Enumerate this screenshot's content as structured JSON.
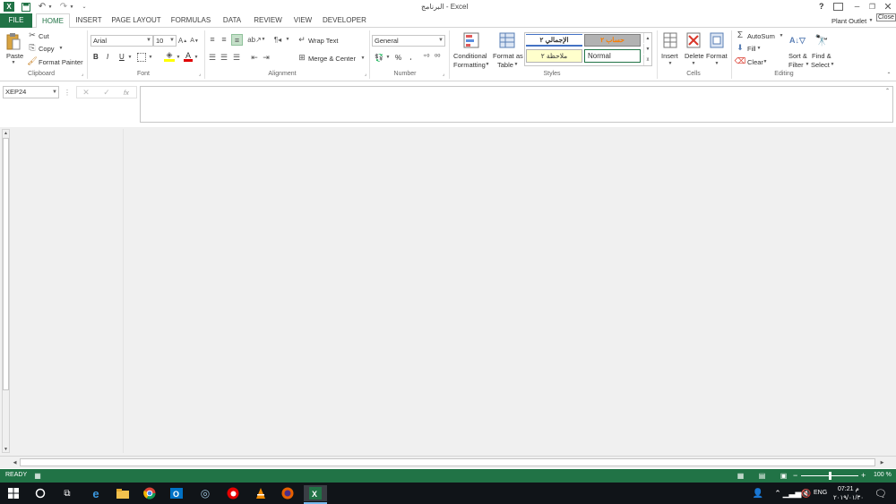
{
  "window": {
    "title": "البرنامج - Excel",
    "close_tooltip": "Close",
    "account": "Plant Outlet",
    "help": "?"
  },
  "tabs": [
    {
      "label": "FILE"
    },
    {
      "label": "HOME"
    },
    {
      "label": "INSERT"
    },
    {
      "label": "PAGE LAYOUT"
    },
    {
      "label": "FORMULAS"
    },
    {
      "label": "DATA"
    },
    {
      "label": "REVIEW"
    },
    {
      "label": "VIEW"
    },
    {
      "label": "DEVELOPER"
    }
  ],
  "ribbon": {
    "clipboard": {
      "paste": "Paste",
      "cut": "Cut",
      "copy": "Copy",
      "format_painter": "Format Painter",
      "label": "Clipboard"
    },
    "font": {
      "name": "Arial",
      "size": "10",
      "bold": "B",
      "italic": "I",
      "underline": "U",
      "label": "Font"
    },
    "alignment": {
      "wrap_text": "Wrap Text",
      "merge_center": "Merge & Center",
      "label": "Alignment"
    },
    "number": {
      "format": "General",
      "percent": "%",
      "comma": "،",
      "inc_decimal": "⁺⁰",
      "dec_decimal": "⁰⁰",
      "label": "Number"
    },
    "styles": {
      "conditional_1": "Conditional",
      "conditional_2": "Formatting",
      "format_table_1": "Format as",
      "format_table_2": "Table",
      "cell_styles": [
        "الإجمالي ٢",
        "حساب ٢",
        "ملاحظة ٢",
        "Normal"
      ],
      "label": "Styles"
    },
    "cells": {
      "insert": "Insert",
      "delete": "Delete",
      "format": "Format",
      "label": "Cells"
    },
    "editing": {
      "autosum": "AutoSum",
      "fill": "Fill",
      "clear": "Clear",
      "sort_1": "Sort &",
      "sort_2": "Filter",
      "find_1": "Find &",
      "find_2": "Select",
      "label": "Editing"
    }
  },
  "formula_bar": {
    "name_box": "XEP24",
    "fx": "fx",
    "value": ""
  },
  "status": {
    "ready": "READY",
    "zoom": "100 %"
  },
  "taskbar": {
    "lang": "ENG",
    "time": "07:21 م",
    "date": "٢٠١٩/٠١/٣٠"
  },
  "colors": {
    "excel_green": "#217346",
    "taskbar": "#101418",
    "sheet_bg": "#f0f0f0"
  }
}
